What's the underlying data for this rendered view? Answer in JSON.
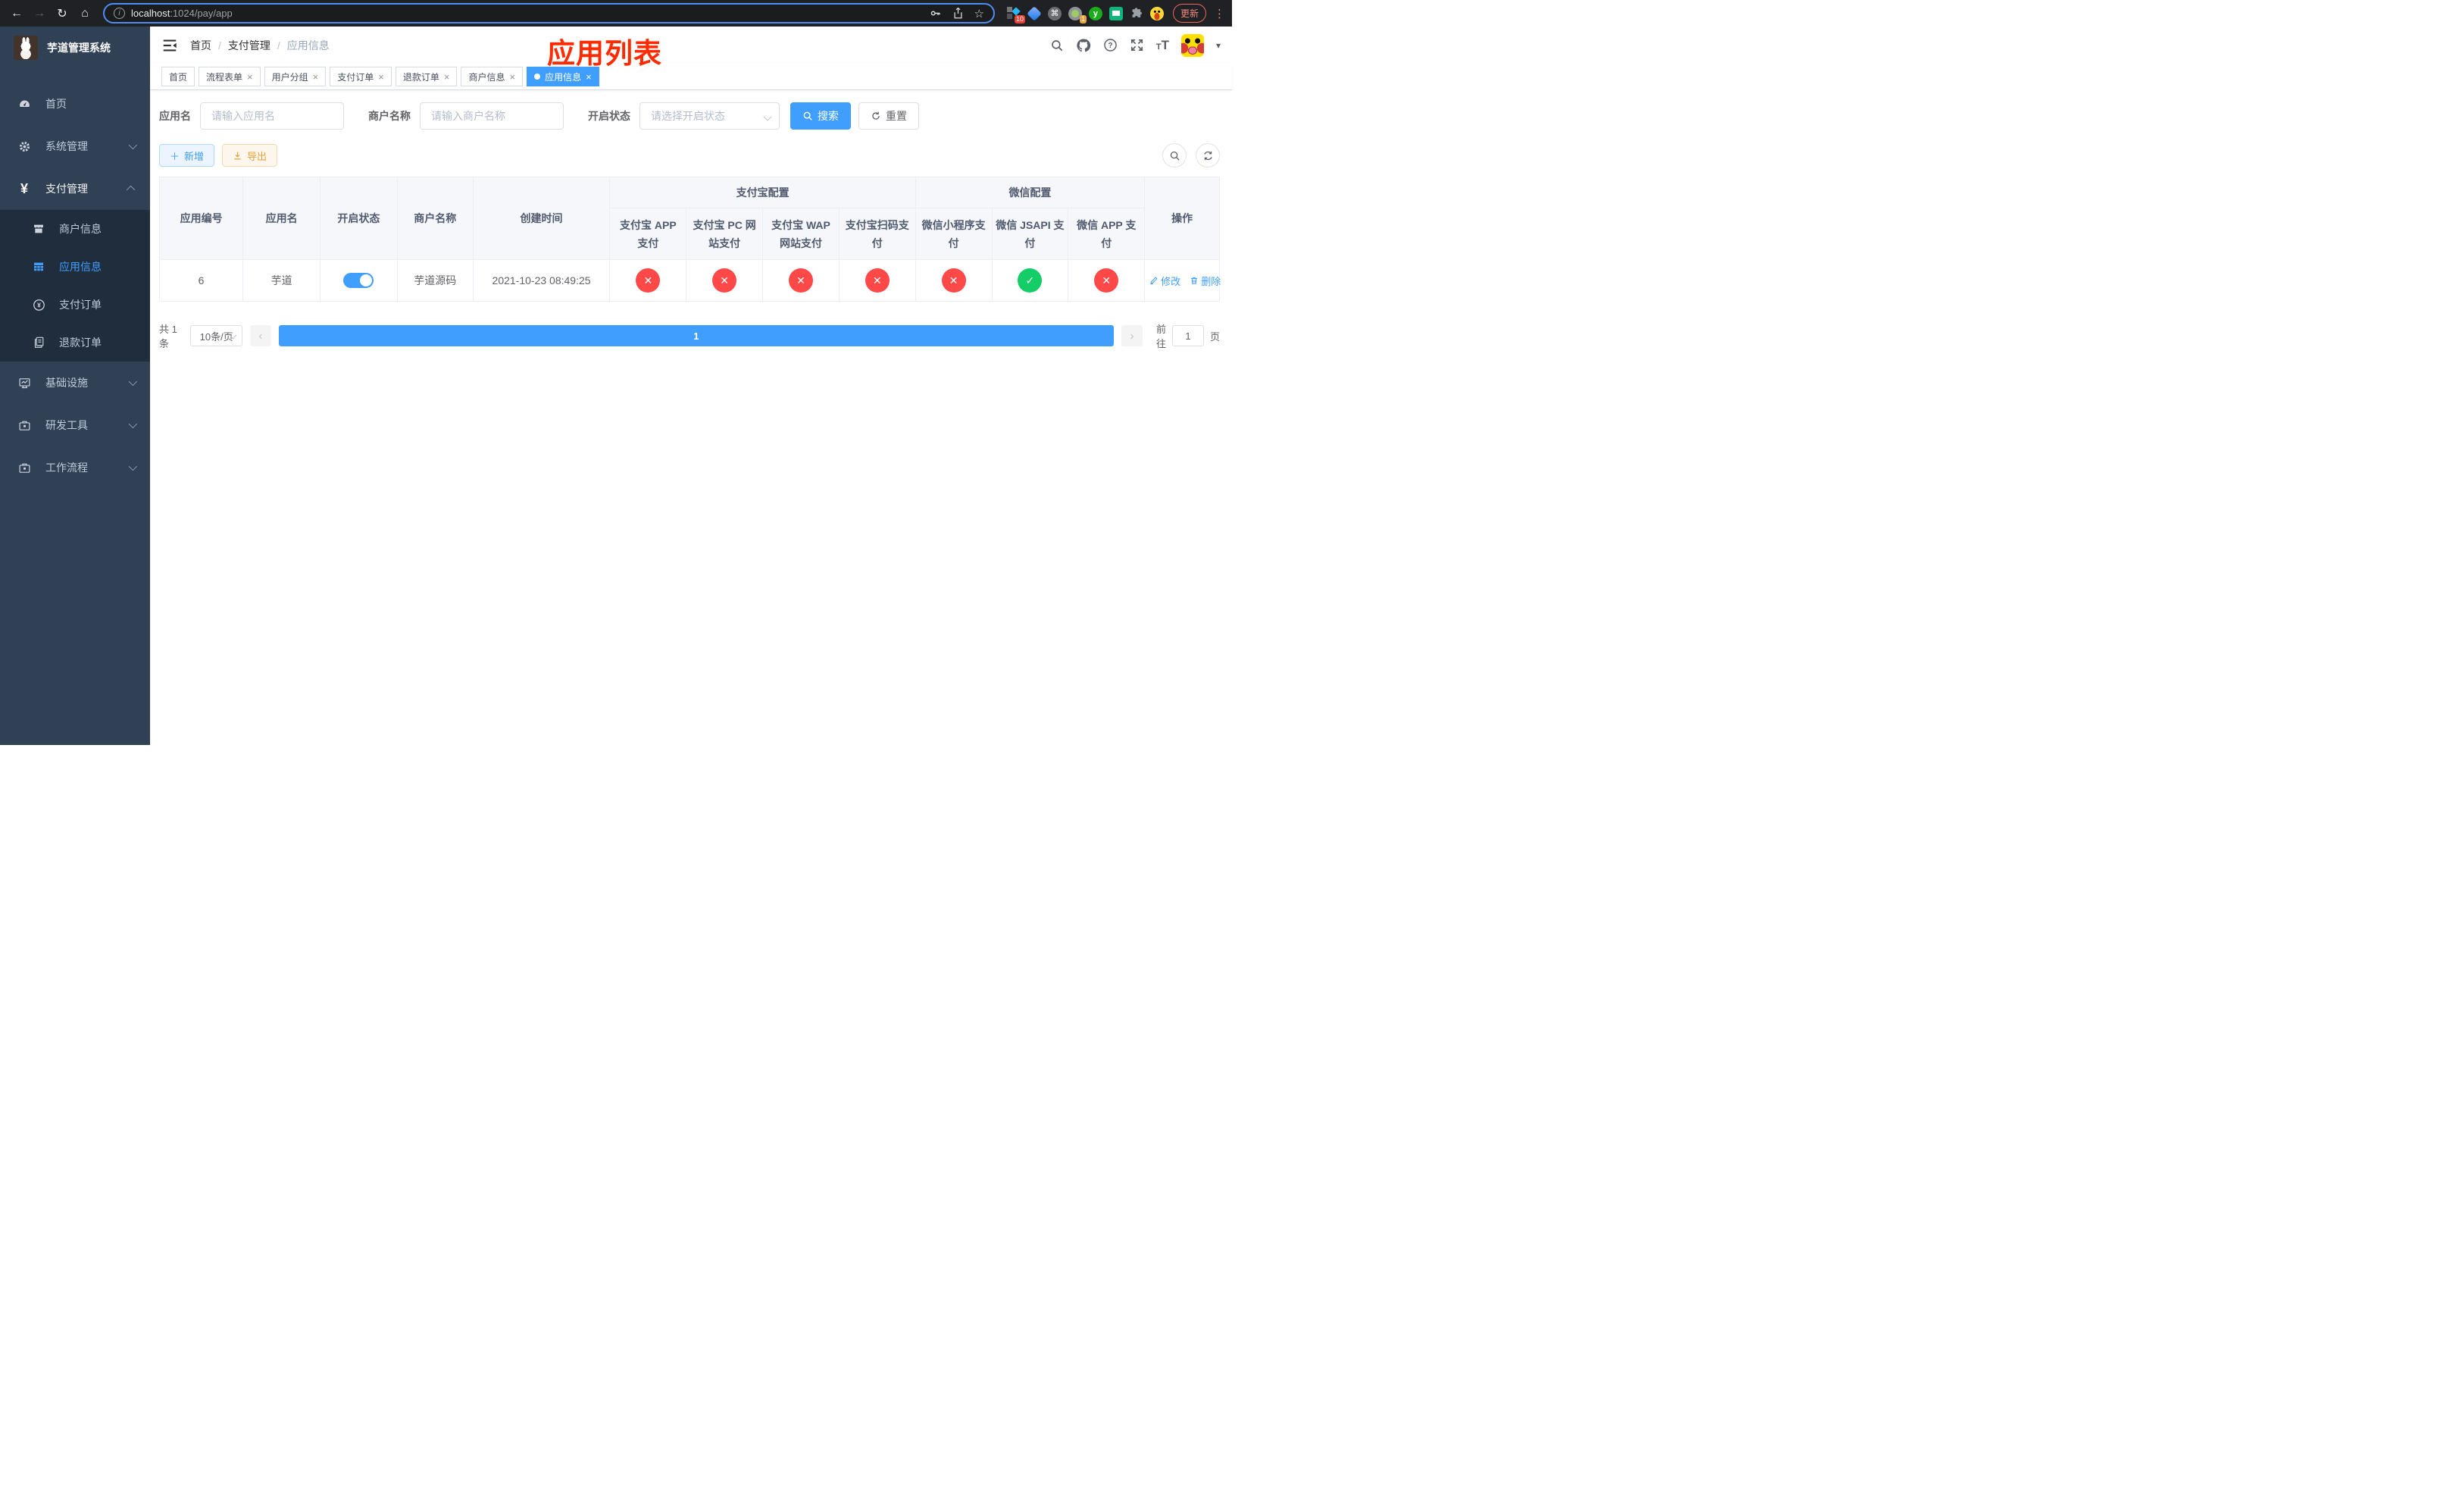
{
  "browser": {
    "url": {
      "host": "localhost",
      "rest": ":1024/pay/app"
    },
    "update_label": "更新",
    "ext_badge_grid": "10",
    "ext_badge_cam": "1"
  },
  "icons": {
    "back": "←",
    "forward": "→",
    "reload": "↻",
    "home": "⌂",
    "info": "i",
    "star": "☆",
    "command": "⌘",
    "y_letter": "y",
    "more": "⋮",
    "close": "×",
    "check": "✓",
    "cross": "✕",
    "caret": "▾",
    "prev": "‹",
    "next": "›",
    "plus": "＋",
    "question": "?",
    "yen": "¥",
    "t_small": "T",
    "t_large": "T"
  },
  "sidebar": {
    "logo_title": "芋道管理系统",
    "items": [
      {
        "label": "首页"
      },
      {
        "label": "系统管理"
      },
      {
        "label": "支付管理"
      },
      {
        "label": "基础设施"
      },
      {
        "label": "研发工具"
      },
      {
        "label": "工作流程"
      }
    ],
    "payment_children": [
      {
        "label": "商户信息"
      },
      {
        "label": "应用信息"
      },
      {
        "label": "支付订单"
      },
      {
        "label": "退款订单"
      }
    ]
  },
  "navbar": {
    "breadcrumb": [
      "首页",
      "支付管理",
      "应用信息"
    ]
  },
  "annotation": "应用列表",
  "tags": [
    {
      "label": "首页"
    },
    {
      "label": "流程表单"
    },
    {
      "label": "用户分组"
    },
    {
      "label": "支付订单"
    },
    {
      "label": "退款订单"
    },
    {
      "label": "商户信息"
    },
    {
      "label": "应用信息"
    }
  ],
  "filters": {
    "app_name_label": "应用名",
    "app_name_placeholder": "请输入应用名",
    "merchant_label": "商户名称",
    "merchant_placeholder": "请输入商户名称",
    "status_label": "开启状态",
    "status_placeholder": "请选择开启状态",
    "search_label": "搜索",
    "reset_label": "重置"
  },
  "toolbar": {
    "add_label": "新增",
    "export_label": "导出"
  },
  "table": {
    "columns": {
      "app_id": "应用编号",
      "app_name": "应用名",
      "status": "开启状态",
      "merchant": "商户名称",
      "created": "创建时间",
      "alipay_group": "支付宝配置",
      "wechat_group": "微信配置",
      "actions": "操作",
      "pay_channels": [
        "支付宝 APP 支付",
        "支付宝 PC 网站支付",
        "支付宝 WAP 网站支付",
        "支付宝扫码支付",
        "微信小程序支付",
        "微信 JSAPI 支付",
        "微信 APP 支付"
      ]
    },
    "row": {
      "app_id": "6",
      "app_name": "芋道",
      "enabled": true,
      "merchant": "芋道源码",
      "created": "2021-10-23 08:49:25",
      "pay_status": [
        false,
        false,
        false,
        false,
        false,
        true,
        false
      ],
      "edit_label": "修改",
      "delete_label": "删除"
    }
  },
  "pagination": {
    "total": "共 1 条",
    "page_size": "10条/页",
    "current_page": "1",
    "goto_label": "前往",
    "goto_value": "1",
    "page_suffix": "页"
  },
  "colors": {
    "primary": "#409EFF",
    "success": "#13ce66",
    "danger": "#ff4949"
  }
}
